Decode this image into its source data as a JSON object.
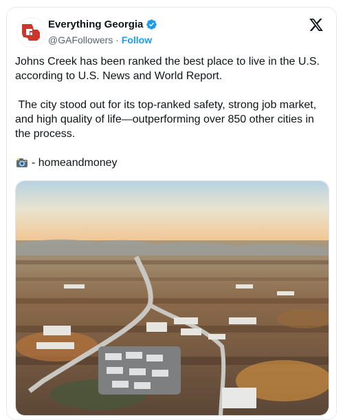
{
  "post": {
    "author": {
      "display_name": "Everything Georgia",
      "handle": "@GAFollowers",
      "separator": "·",
      "follow_label": "Follow",
      "verified": true,
      "avatar_icon": "georgia-state-logo",
      "avatar_color": "#d0342c"
    },
    "platform_icon": "x-logo-icon",
    "text": {
      "para1": "Johns Creek has been ranked the best place to live in the U.S. according to U.S. News and World Report.",
      "para2": "The city stood out for its top-ranked safety, strong job market, and high quality of life—outperforming over 850 other cities in the process.",
      "credit": "- homeandmoney",
      "credit_icon": "camera-emoji-icon"
    },
    "media": {
      "type": "photo",
      "subject": "aerial-city-view",
      "sky_color": "#f3d6a1",
      "land_color": "#7a5a3c"
    },
    "colors": {
      "accent": "#1d9bf0",
      "text": "#0f1419",
      "secondary": "#536471"
    }
  }
}
